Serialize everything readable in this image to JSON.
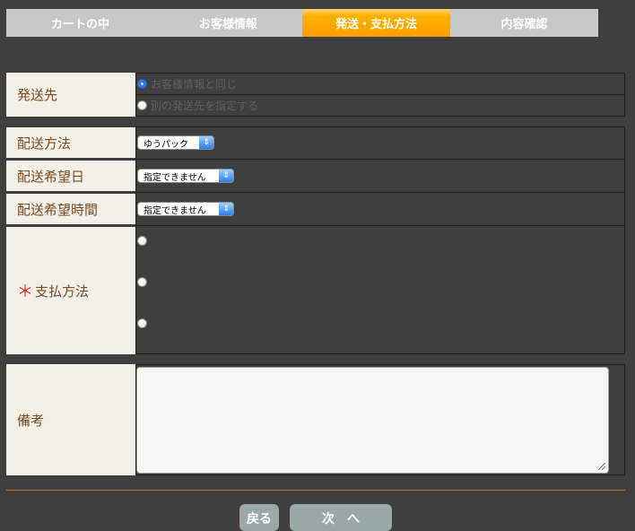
{
  "steps": [
    {
      "label": "カートの中",
      "active": false
    },
    {
      "label": "お客様情報",
      "active": false
    },
    {
      "label": "発送・支払方法",
      "active": true
    },
    {
      "label": "内容確認",
      "active": false
    }
  ],
  "shipping_destination": {
    "label": "発送先",
    "options": [
      {
        "label": "お客様情報と同じ",
        "checked": true
      },
      {
        "label": "別の発送先を指定する",
        "checked": false
      }
    ]
  },
  "delivery_method": {
    "label": "配送方法",
    "selected": "ゆうパック"
  },
  "delivery_date": {
    "label": "配送希望日",
    "selected": "指定できません"
  },
  "delivery_time": {
    "label": "配送希望時間",
    "selected": "指定できません"
  },
  "payment_method": {
    "label": "支払方法",
    "required_mark": "＊",
    "option_count": 3
  },
  "remarks": {
    "label": "備考",
    "value": ""
  },
  "buttons": {
    "back": "戻る",
    "next": "次　へ"
  },
  "colors": {
    "accent": "#ffa500",
    "background": "#3f3f3f",
    "label_bg": "#f3f0e7",
    "label_text": "#7a4b22",
    "required": "#e0261e",
    "rule": "#d36a1a"
  }
}
